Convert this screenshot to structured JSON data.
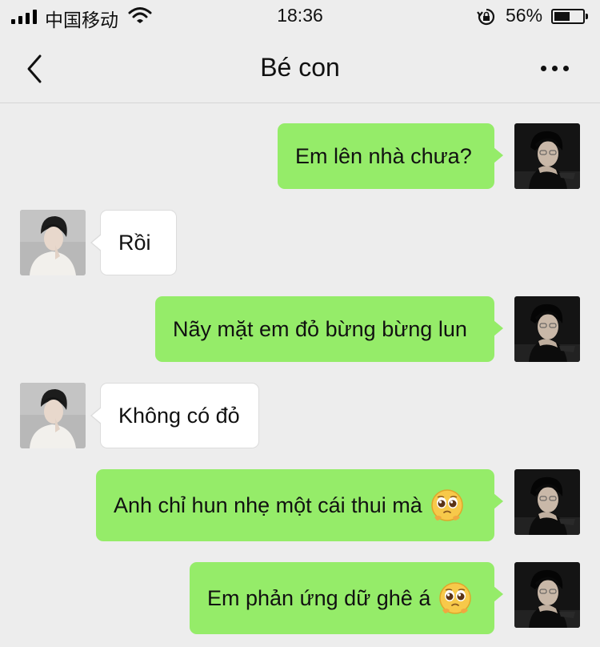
{
  "status_bar": {
    "carrier": "中国移动",
    "time": "18:36",
    "battery_percent": "56%",
    "battery_level": 0.56,
    "signal_icon": "signal-bars-icon",
    "wifi_icon": "wifi-icon",
    "lock_icon": "rotation-lock-icon"
  },
  "nav": {
    "title": "Bé con",
    "back_icon": "chevron-left-icon",
    "more_icon": "more-dots-icon"
  },
  "colors": {
    "background": "#ededed",
    "my_bubble": "#95ec69",
    "their_bubble": "#ffffff"
  },
  "messages": [
    {
      "sender": "me",
      "text": "Em lên nhà chưa?"
    },
    {
      "sender": "them",
      "text": "Rồi"
    },
    {
      "sender": "me",
      "text": "Nãy mặt em đỏ bừng bừng lun"
    },
    {
      "sender": "them",
      "text": "Không có đỏ"
    },
    {
      "sender": "me",
      "text": "Anh chỉ hun nhẹ một cái thui mà",
      "emoji": "pleading-face-emoji"
    },
    {
      "sender": "me",
      "text": "Em phản ứng dữ ghê á",
      "emoji": "pleading-face-emoji"
    }
  ]
}
